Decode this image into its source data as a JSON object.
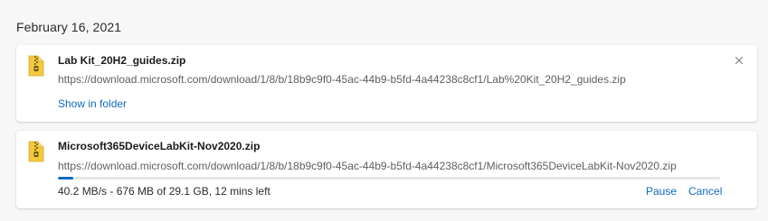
{
  "date_header": "February 16, 2021",
  "downloads": [
    {
      "file_name": "Lab Kit_20H2_guides.zip",
      "url": "https://download.microsoft.com/download/1/8/b/18b9c9f0-45ac-44b9-b5fd-4a44238c8cf1/Lab%20Kit_20H2_guides.zip",
      "action_label": "Show in folder",
      "icon": "zip-folder-icon"
    },
    {
      "file_name": "Microsoft365DeviceLabKit-Nov2020.zip",
      "url": "https://download.microsoft.com/download/1/8/b/18b9c9f0-45ac-44b9-b5fd-4a44238c8cf1/Microsoft365DeviceLabKit-Nov2020.zip",
      "status": "40.2 MB/s - 676 MB of 29.1 GB, 12 mins left",
      "progress_fraction": 0.023,
      "pause_label": "Pause",
      "cancel_label": "Cancel",
      "icon": "zip-folder-icon"
    }
  ],
  "colors": {
    "accent": "#0f6cbd",
    "background": "#f7f7f7",
    "card": "#ffffff",
    "zip_yellow": "#f3c93d"
  }
}
